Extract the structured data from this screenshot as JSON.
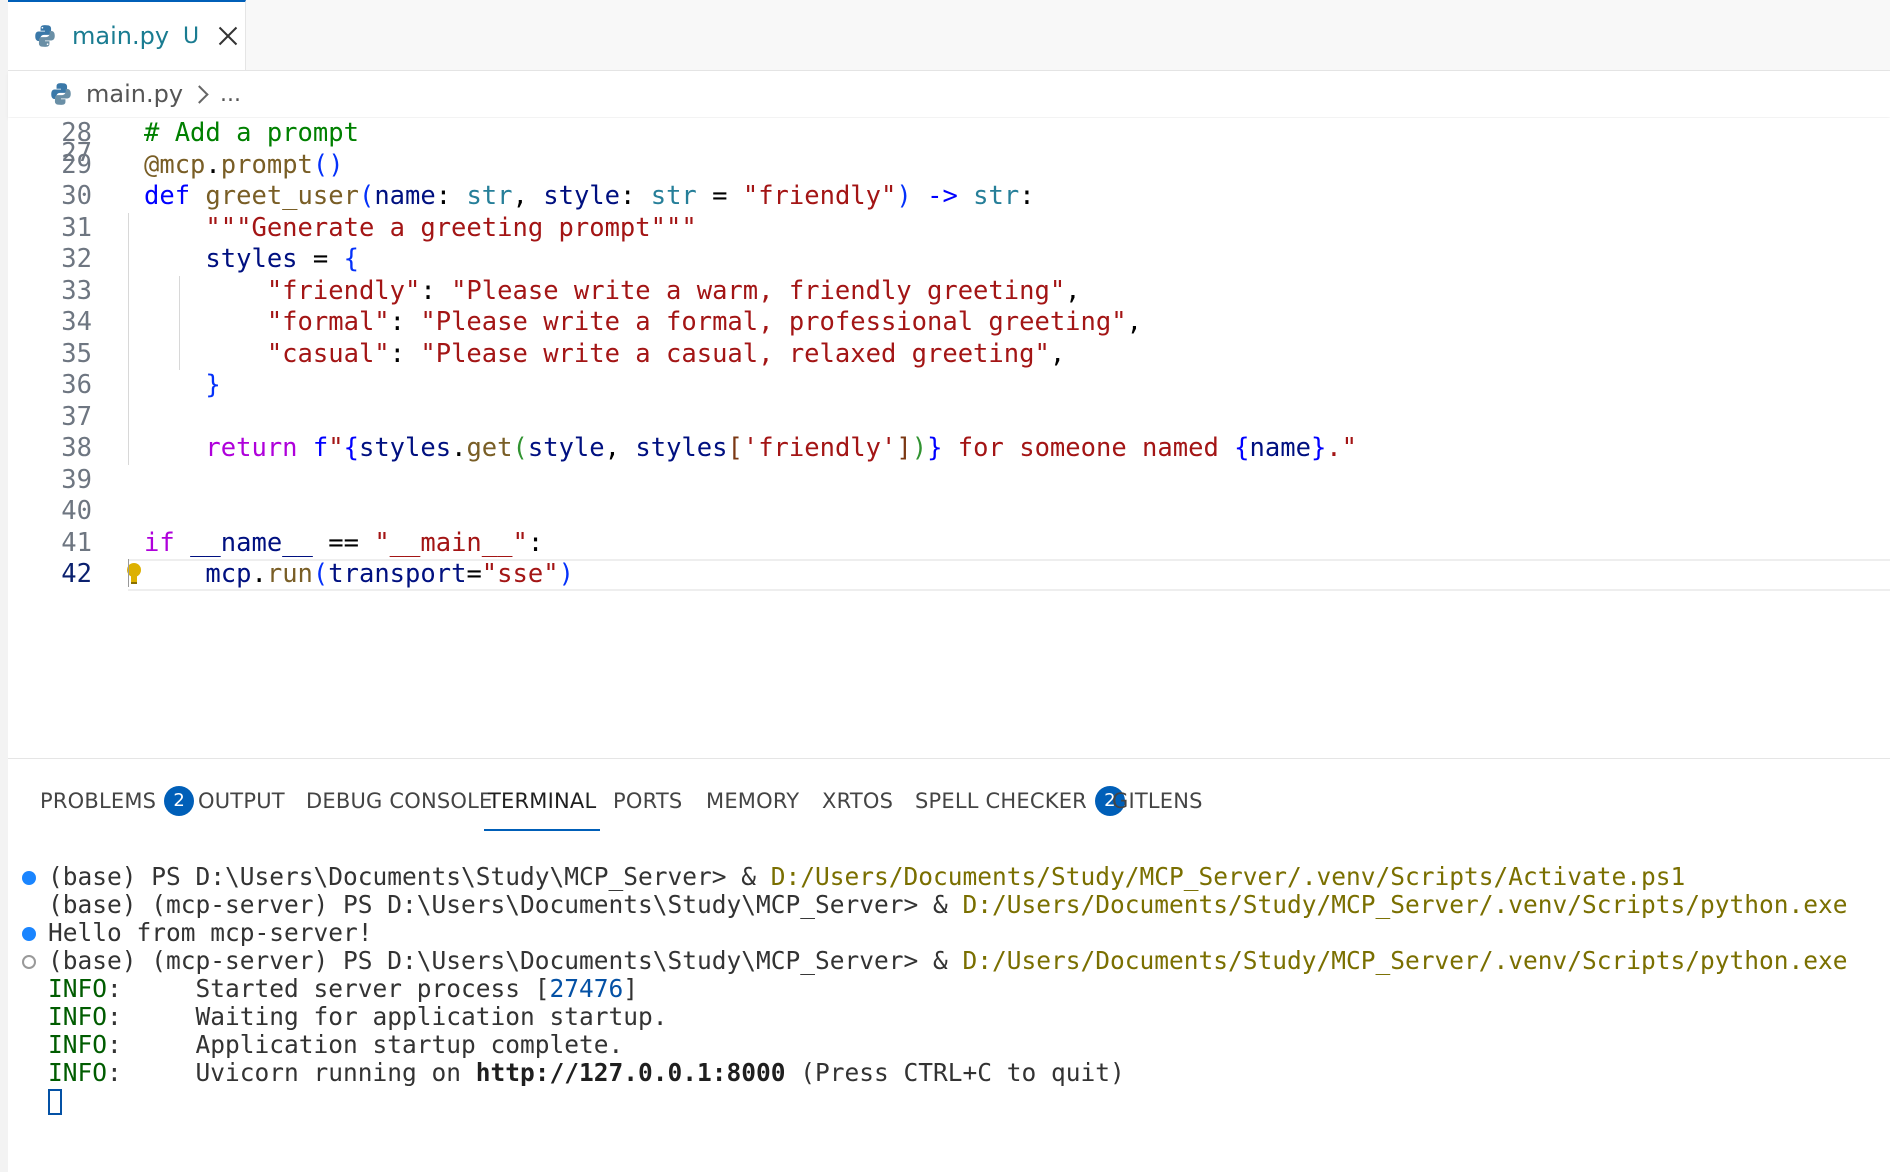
{
  "tab": {
    "filename": "main.py",
    "status": "U"
  },
  "breadcrumb": {
    "file": "main.py",
    "ellipsis": "..."
  },
  "editor": {
    "partial_line_number": "27",
    "active_line": 42,
    "lines": [
      {
        "n": "28",
        "segments": [
          [
            "c-com",
            "# Add a prompt"
          ]
        ]
      },
      {
        "n": "29",
        "segments": [
          [
            "c-fn",
            "@mcp"
          ],
          [
            "c-punc",
            "."
          ],
          [
            "c-fn",
            "prompt"
          ],
          [
            "c-br1",
            "()"
          ]
        ]
      },
      {
        "n": "30",
        "segments": [
          [
            "c-kw",
            "def "
          ],
          [
            "c-fn",
            "greet_user"
          ],
          [
            "c-br1",
            "("
          ],
          [
            "c-var",
            "name"
          ],
          [
            "c-punc",
            ": "
          ],
          [
            "c-type",
            "str"
          ],
          [
            "c-punc",
            ", "
          ],
          [
            "c-var",
            "style"
          ],
          [
            "c-punc",
            ": "
          ],
          [
            "c-type",
            "str"
          ],
          [
            "c-punc",
            " = "
          ],
          [
            "c-str",
            "\"friendly\""
          ],
          [
            "c-br1",
            ")"
          ],
          [
            "c-punc",
            " "
          ],
          [
            "c-kw",
            "->"
          ],
          [
            "c-punc",
            " "
          ],
          [
            "c-type",
            "str"
          ],
          [
            "c-punc",
            ":"
          ]
        ]
      },
      {
        "n": "31",
        "segments": [
          [
            "c-punc",
            "    "
          ],
          [
            "c-str",
            "\"\"\"Generate a greeting prompt\"\"\""
          ]
        ]
      },
      {
        "n": "32",
        "segments": [
          [
            "c-punc",
            "    "
          ],
          [
            "c-var",
            "styles"
          ],
          [
            "c-punc",
            " = "
          ],
          [
            "c-br1",
            "{"
          ]
        ]
      },
      {
        "n": "33",
        "segments": [
          [
            "c-punc",
            "        "
          ],
          [
            "c-str",
            "\"friendly\""
          ],
          [
            "c-punc",
            ": "
          ],
          [
            "c-str",
            "\"Please write a warm, friendly greeting\""
          ],
          [
            "c-punc",
            ","
          ]
        ]
      },
      {
        "n": "34",
        "segments": [
          [
            "c-punc",
            "        "
          ],
          [
            "c-str",
            "\"formal\""
          ],
          [
            "c-punc",
            ": "
          ],
          [
            "c-str",
            "\"Please write a formal, professional greeting\""
          ],
          [
            "c-punc",
            ","
          ]
        ]
      },
      {
        "n": "35",
        "segments": [
          [
            "c-punc",
            "        "
          ],
          [
            "c-str",
            "\"casual\""
          ],
          [
            "c-punc",
            ": "
          ],
          [
            "c-str",
            "\"Please write a casual, relaxed greeting\""
          ],
          [
            "c-punc",
            ","
          ]
        ]
      },
      {
        "n": "36",
        "segments": [
          [
            "c-punc",
            "    "
          ],
          [
            "c-br1",
            "}"
          ]
        ]
      },
      {
        "n": "37",
        "segments": []
      },
      {
        "n": "38",
        "segments": [
          [
            "c-punc",
            "    "
          ],
          [
            "c-ctl",
            "return "
          ],
          [
            "c-kw",
            "f"
          ],
          [
            "c-str",
            "\""
          ],
          [
            "c-kw",
            "{"
          ],
          [
            "c-var",
            "styles"
          ],
          [
            "c-punc",
            "."
          ],
          [
            "c-fn",
            "get"
          ],
          [
            "c-br2",
            "("
          ],
          [
            "c-var",
            "style"
          ],
          [
            "c-punc",
            ", "
          ],
          [
            "c-var",
            "styles"
          ],
          [
            "c-br3",
            "["
          ],
          [
            "c-str",
            "'friendly'"
          ],
          [
            "c-br3",
            "]"
          ],
          [
            "c-br2",
            ")"
          ],
          [
            "c-kw",
            "}"
          ],
          [
            "c-str",
            " for someone named "
          ],
          [
            "c-kw",
            "{"
          ],
          [
            "c-var",
            "name"
          ],
          [
            "c-kw",
            "}"
          ],
          [
            "c-str",
            ".\""
          ]
        ]
      },
      {
        "n": "39",
        "segments": []
      },
      {
        "n": "40",
        "segments": []
      },
      {
        "n": "41",
        "segments": [
          [
            "c-ctl",
            "if "
          ],
          [
            "c-var",
            "__name__"
          ],
          [
            "c-punc",
            " == "
          ],
          [
            "c-str",
            "\"__main__\""
          ],
          [
            "c-punc",
            ":"
          ]
        ]
      },
      {
        "n": "42",
        "segments": [
          [
            "c-punc",
            "    "
          ],
          [
            "c-var",
            "mcp"
          ],
          [
            "c-punc",
            "."
          ],
          [
            "c-fn",
            "run"
          ],
          [
            "c-br1",
            "("
          ],
          [
            "c-var",
            "transport"
          ],
          [
            "c-punc",
            "="
          ],
          [
            "c-str",
            "\"sse\""
          ],
          [
            "c-br1",
            ")"
          ]
        ]
      }
    ]
  },
  "panel": {
    "tabs": [
      {
        "label": "PROBLEMS",
        "badge": "2"
      },
      {
        "label": "OUTPUT"
      },
      {
        "label": "DEBUG CONSOLE"
      },
      {
        "label": "TERMINAL",
        "active": true
      },
      {
        "label": "PORTS"
      },
      {
        "label": "MEMORY"
      },
      {
        "label": "XRTOS"
      },
      {
        "label": "SPELL CHECKER",
        "badge": "2"
      },
      {
        "label": "GITLENS"
      }
    ]
  },
  "terminal": {
    "lines": [
      {
        "dot": "blue",
        "segments": [
          [
            "",
            "(base) PS D:\\Users\\Documents\\Study\\MCP_Server> & "
          ],
          [
            "t-path",
            "D:/Users/Documents/Study/MCP_Server/.venv/Scripts/Activate.ps1"
          ]
        ]
      },
      {
        "dot": "",
        "segments": [
          [
            "",
            "(base) (mcp-server) PS D:\\Users\\Documents\\Study\\MCP_Server> & "
          ],
          [
            "t-path",
            "D:/Users/Documents/Study/MCP_Server/.venv/Scripts/python.exe"
          ]
        ]
      },
      {
        "dot": "blue",
        "segments": [
          [
            "",
            "Hello from mcp-server!"
          ]
        ]
      },
      {
        "dot": "hollow",
        "segments": [
          [
            "",
            "(base) (mcp-server) PS D:\\Users\\Documents\\Study\\MCP_Server> & "
          ],
          [
            "t-path",
            "D:/Users/Documents/Study/MCP_Server/.venv/Scripts/python.exe"
          ]
        ]
      },
      {
        "dot": "",
        "segments": [
          [
            "t-info",
            "INFO"
          ],
          [
            "",
            ":     Started server process ["
          ],
          [
            "t-num",
            "27476"
          ],
          [
            "",
            "]"
          ]
        ]
      },
      {
        "dot": "",
        "segments": [
          [
            "t-info",
            "INFO"
          ],
          [
            "",
            ":     Waiting for application startup."
          ]
        ]
      },
      {
        "dot": "",
        "segments": [
          [
            "t-info",
            "INFO"
          ],
          [
            "",
            ":     Application startup complete."
          ]
        ]
      },
      {
        "dot": "",
        "segments": [
          [
            "t-info",
            "INFO"
          ],
          [
            "",
            ":     Uvicorn running on "
          ],
          [
            "t-bold",
            "http://127.0.0.1:8000"
          ],
          [
            "",
            " (Press CTRL+C to quit)"
          ]
        ]
      }
    ]
  }
}
